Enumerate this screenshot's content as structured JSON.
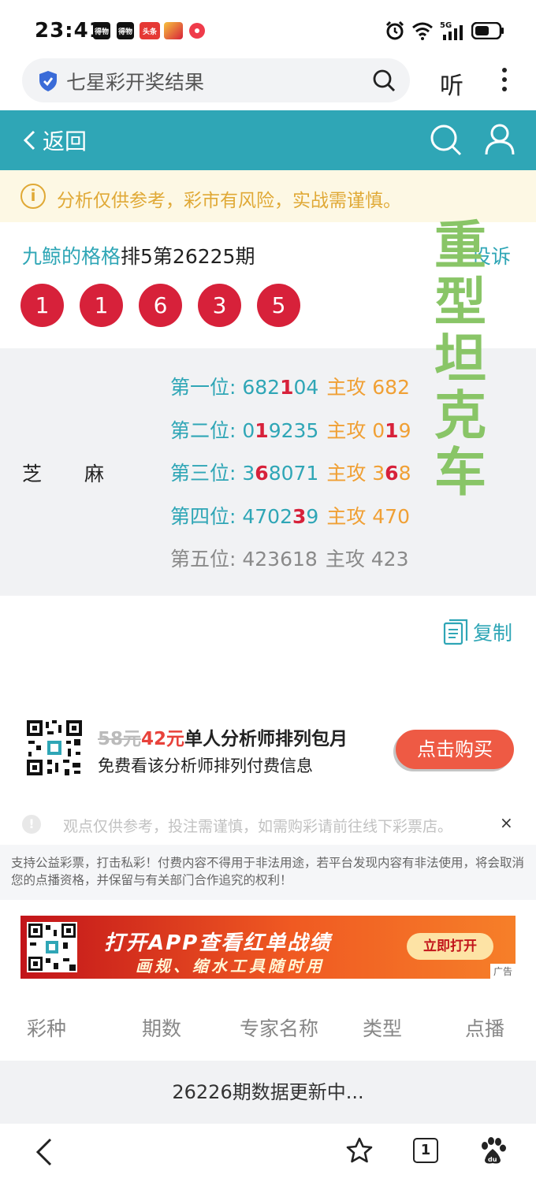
{
  "status_bar": {
    "time": "23:41",
    "notifications": [
      "得物",
      "得物",
      "头条"
    ],
    "network": "5G"
  },
  "browser": {
    "search_text": "七星彩开奖结果",
    "listen_label": "听"
  },
  "header": {
    "back_label": "返回"
  },
  "warning": {
    "icon": "i",
    "text": "分析仅供参考，彩市有风险，实战需谨慎。"
  },
  "post": {
    "author": "九鲸的格格",
    "title_suffix": "排5第26225期",
    "complain_label": "投诉",
    "balls": [
      "1",
      "1",
      "6",
      "3",
      "5"
    ]
  },
  "analysis": {
    "name_left": "芝",
    "name_right": "麻",
    "rows": [
      {
        "label": "第一位: ",
        "pre": "682",
        "hl": "1",
        "post": "04",
        "atk_label": "主攻 ",
        "atk_pre": "682",
        "atk_hl": "",
        "atk_post": ""
      },
      {
        "label": "第二位: ",
        "pre": "0",
        "hl": "1",
        "post": "9235",
        "atk_label": "主攻 ",
        "atk_pre": "0",
        "atk_hl": "1",
        "atk_post": "9"
      },
      {
        "label": "第三位: ",
        "pre": "3",
        "hl": "6",
        "post": "8071",
        "atk_label": "主攻 ",
        "atk_pre": "3",
        "atk_hl": "6",
        "atk_post": "8"
      },
      {
        "label": "第四位: ",
        "pre": "4702",
        "hl": "3",
        "post": "9",
        "atk_label": "主攻 ",
        "atk_pre": "470",
        "atk_hl": "",
        "atk_post": ""
      },
      {
        "label": "第五位: ",
        "pre": "423618",
        "hl": "",
        "post": "",
        "atk_label": "主攻 ",
        "atk_pre": "423",
        "atk_hl": "",
        "atk_post": ""
      }
    ],
    "overlay_chars": [
      "重",
      "型",
      "坦",
      "克",
      "车"
    ]
  },
  "copy_label": "复制",
  "purchase": {
    "old_price": "58元",
    "new_price": "42元",
    "title": "单人分析师排列包月",
    "subtitle": "免费看该分析师排列付费信息",
    "button": "点击购买"
  },
  "notice": {
    "text": "观点仅供参考，投注需谨慎，如需购彩请前往线下彩票店。",
    "close": "×"
  },
  "disclaimer": "支持公益彩票，打击私彩！付费内容不得用于非法用途，若平台发现内容有非法使用，将会取消您的点播资格，并保留与有关部门合作追究的权利！",
  "banner": {
    "line1": "打开APP查看红单战绩",
    "line2": "画规、缩水工具随时用",
    "button": "立即打开",
    "ad_tag": "广告"
  },
  "table": {
    "headers": [
      "彩种",
      "期数",
      "专家名称",
      "类型",
      "点播"
    ],
    "status_row": "26226期数据更新中..."
  },
  "bottom_nav": {
    "tab_count": "1"
  },
  "colors": {
    "teal": "#2fa6b6",
    "ball_red": "#d7213a",
    "attack_orange": "#f0a035",
    "warning_yellow": "#e0a936",
    "overlay_green": "#89c567",
    "buy_button": "#ee5a44"
  }
}
